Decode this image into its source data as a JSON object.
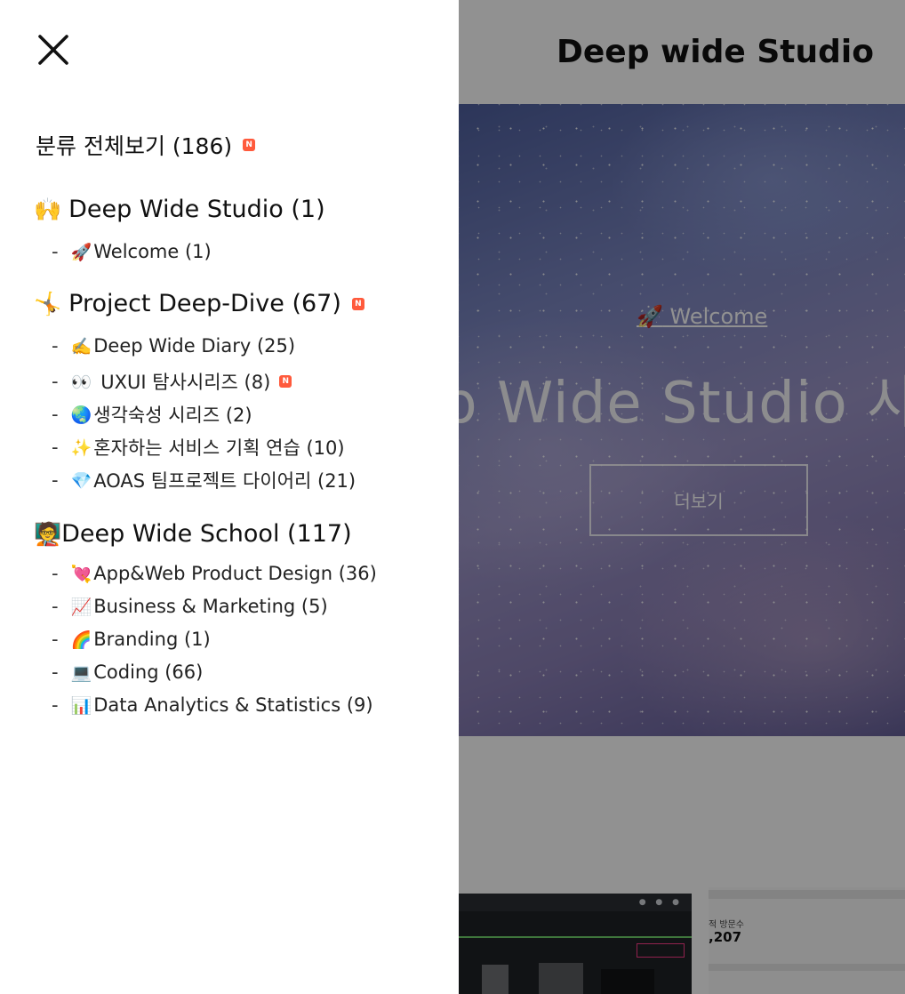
{
  "page": {
    "title": "Deep wide Studio",
    "hero": {
      "link_icon": "🚀",
      "link_text": "Welcome",
      "headline": "p Wide Studio 사용",
      "button_label": "더보기"
    },
    "stat_card": {
      "label": "적 방문수",
      "value": ",207"
    },
    "colors": {
      "overlay": "#00000070",
      "new_badge": "#ff5a3c"
    }
  },
  "drawer": {
    "close_icon": "close-icon",
    "category_all": {
      "label": "분류 전체보기 (186)",
      "badge": "N"
    },
    "groups": [
      {
        "emoji": "🙌",
        "label": "Deep Wide Studio (1)",
        "items": [
          {
            "emoji": "🚀",
            "label": "Welcome (1)"
          }
        ]
      },
      {
        "emoji": "🤸",
        "label": "Project Deep-Dive (67)",
        "badge": "N",
        "items": [
          {
            "emoji": "✍️",
            "label": "Deep Wide Diary (25)"
          },
          {
            "emoji": "👀",
            "label": "UXUI 탐사시리즈 (8)",
            "badge": "N"
          },
          {
            "emoji": "🌏",
            "label": "생각숙성 시리즈 (2)"
          },
          {
            "emoji": "✨",
            "label": "혼자하는 서비스 기획 연습 (10)"
          },
          {
            "emoji": "💎",
            "label": "AOAS 팀프로젝트 다이어리 (21)"
          }
        ]
      },
      {
        "emoji": "🧑‍🏫",
        "label": "Deep Wide School (117)",
        "items": [
          {
            "emoji": "💘",
            "label": "App&Web Product Design (36)"
          },
          {
            "emoji": "📈",
            "label": "Business & Marketing (5)"
          },
          {
            "emoji": "🌈",
            "label": "Branding (1)"
          },
          {
            "emoji": "💻",
            "label": "Coding (66)"
          },
          {
            "emoji": "📊",
            "label": "Data Analytics & Statistics (9)"
          }
        ]
      }
    ]
  }
}
